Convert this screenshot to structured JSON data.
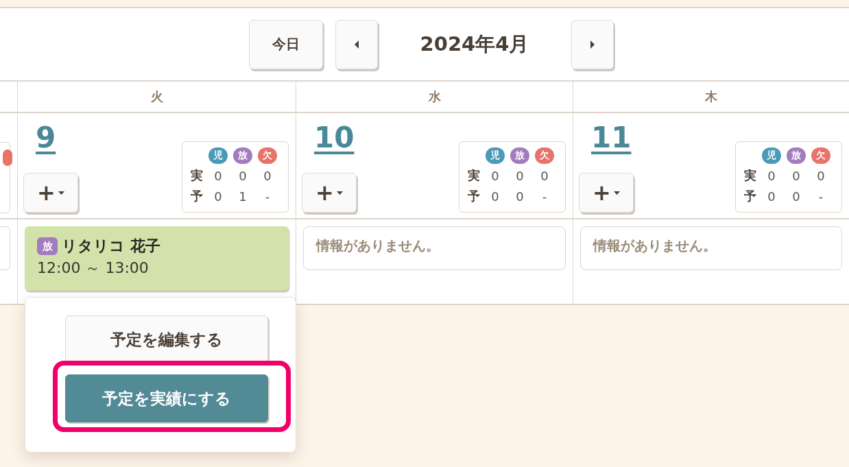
{
  "toolbar": {
    "today_button": "今日",
    "month_title": "2024年4月"
  },
  "days": [
    {
      "weekday": "火",
      "date": "9",
      "add_button": "+",
      "stats": {
        "headers": [
          {
            "label": "児",
            "color": "#4a9ab8"
          },
          {
            "label": "放",
            "color": "#a37cbd"
          },
          {
            "label": "欠",
            "color": "#e8736a"
          }
        ],
        "rows": [
          {
            "label": "実",
            "values": [
              "0",
              "0",
              "0"
            ]
          },
          {
            "label": "予",
            "values": [
              "0",
              "1",
              "-"
            ]
          }
        ]
      },
      "entry": {
        "kind": "schedule",
        "tag": "放",
        "color": "#a37cbd",
        "name": "リタリコ 花子",
        "time": "12:00 ～ 13:00"
      }
    },
    {
      "weekday": "水",
      "date": "10",
      "add_button": "+",
      "stats": {
        "headers": [
          {
            "label": "児",
            "color": "#4a9ab8"
          },
          {
            "label": "放",
            "color": "#a37cbd"
          },
          {
            "label": "欠",
            "color": "#e8736a"
          }
        ],
        "rows": [
          {
            "label": "実",
            "values": [
              "0",
              "0",
              "0"
            ]
          },
          {
            "label": "予",
            "values": [
              "0",
              "0",
              "-"
            ]
          }
        ]
      },
      "entry": {
        "kind": "empty",
        "message": "情報がありません。"
      }
    },
    {
      "weekday": "木",
      "date": "11",
      "add_button": "+",
      "stats": {
        "headers": [
          {
            "label": "児",
            "color": "#4a9ab8"
          },
          {
            "label": "放",
            "color": "#a37cbd"
          },
          {
            "label": "欠",
            "color": "#e8736a"
          }
        ],
        "rows": [
          {
            "label": "実",
            "values": [
              "0",
              "0",
              "0"
            ]
          },
          {
            "label": "予",
            "values": [
              "0",
              "0",
              "-"
            ]
          }
        ]
      },
      "entry": {
        "kind": "empty",
        "message": "情報がありません。"
      }
    }
  ],
  "popup": {
    "buttons": [
      {
        "label": "予定を編集する",
        "kind": "default",
        "highlighted": false
      },
      {
        "label": "予定を実績にする",
        "kind": "primary",
        "highlighted": true
      }
    ]
  }
}
